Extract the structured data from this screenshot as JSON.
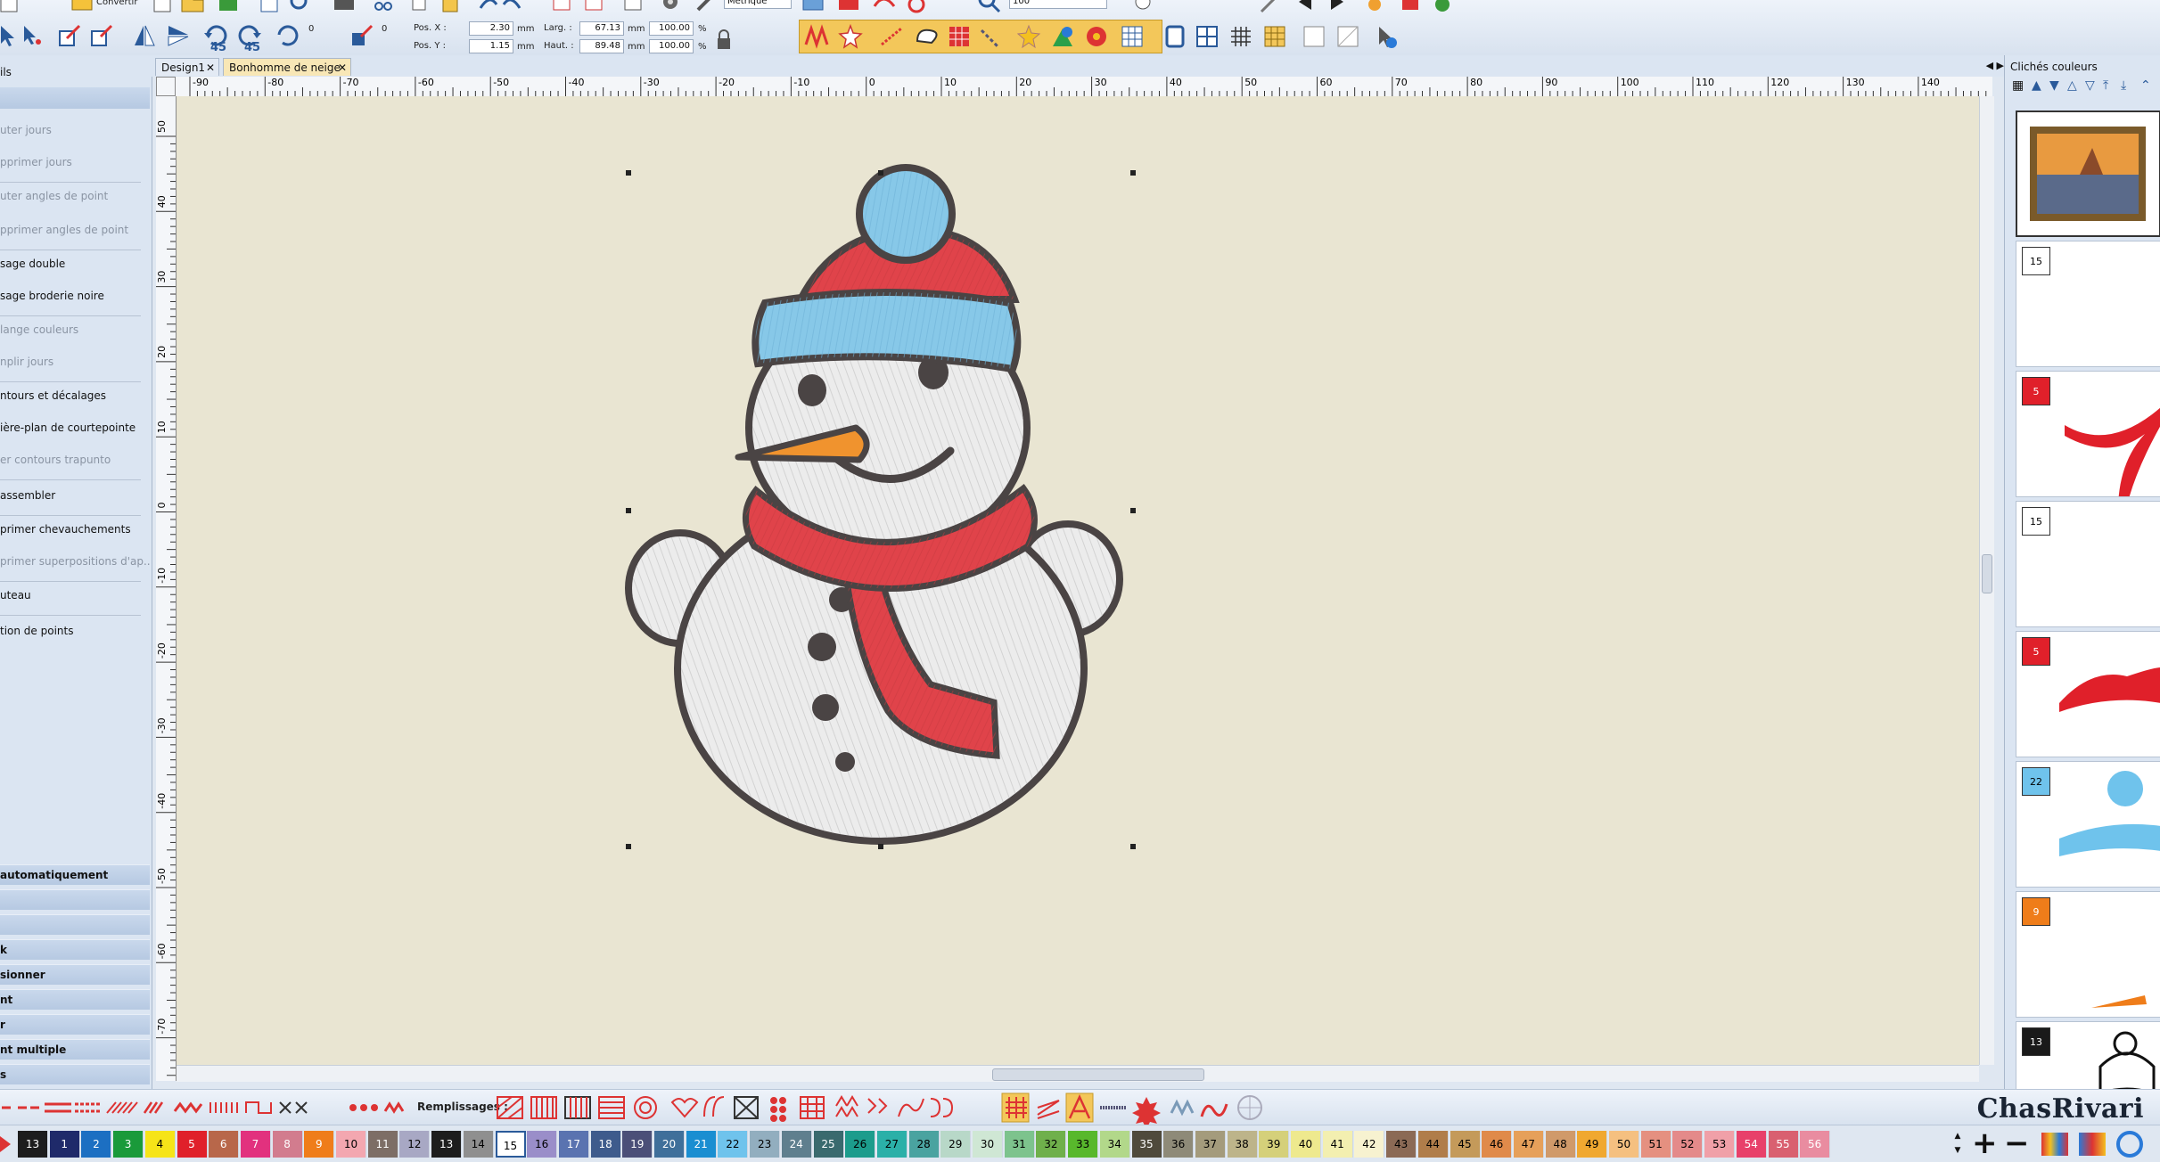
{
  "toolbar": {
    "top_labels": {
      "convert": "Convertir",
      "units": "Métrique",
      "zoom": "100"
    },
    "rotate_left_label": "45",
    "rotate_right_label": "45",
    "angle_value": "0",
    "angle_value_2": "0",
    "pos_x_label": "Pos. X :",
    "pos_x_value": "2.30",
    "pos_y_label": "Pos. Y :",
    "pos_y_value": "1.15",
    "width_label": "Larg. :",
    "width_value": "67.13",
    "height_label": "Haut. :",
    "height_value": "89.48",
    "unit": "mm",
    "width_pct": "100.00",
    "height_pct": "100.00",
    "pct": "%"
  },
  "left_panel": {
    "title": "ils",
    "items": [
      {
        "label": "uter jours",
        "disabled": true
      },
      {
        "label": "pprimer jours",
        "disabled": true
      },
      {
        "label": "uter angles de point",
        "disabled": true
      },
      {
        "label": "pprimer angles de point",
        "disabled": true
      },
      {
        "label": "sage double",
        "disabled": false
      },
      {
        "label": "sage broderie noire",
        "disabled": false
      },
      {
        "label": "lange couleurs",
        "disabled": true
      },
      {
        "label": "nplir jours",
        "disabled": true
      },
      {
        "label": "ntours et décalages",
        "disabled": false
      },
      {
        "label": "ière-plan de courtepointe",
        "disabled": false
      },
      {
        "label": "er contours trapunto",
        "disabled": true
      },
      {
        "label": "assembler",
        "disabled": false
      },
      {
        "label": "primer chevauchements",
        "disabled": false
      },
      {
        "label": "primer superpositions d'ap...",
        "disabled": true
      },
      {
        "label": "uteau",
        "disabled": false
      },
      {
        "label": "tion de points",
        "disabled": false
      }
    ],
    "bands": [
      "automatiquement",
      "",
      "",
      "k",
      "sionner",
      "nt",
      "r",
      "nt multiple",
      "s"
    ]
  },
  "tabs": [
    {
      "label": "Design1",
      "active": false
    },
    {
      "label": "Bonhomme de neige",
      "active": true
    }
  ],
  "ruler": {
    "top": [
      "-90",
      "-80",
      "-70",
      "-60",
      "-50",
      "-40",
      "-30",
      "-20",
      "-10",
      "0",
      "10",
      "20",
      "30",
      "40",
      "50",
      "60",
      "70",
      "80",
      "90",
      "100",
      "110",
      "120",
      "130",
      "140"
    ],
    "left": [
      "50",
      "40",
      "30",
      "20",
      "10",
      "0",
      "-10",
      "-20",
      "-30",
      "-40",
      "-50",
      "-60",
      "-70"
    ]
  },
  "right_panel": {
    "title": "Clichés couleurs",
    "swatches": [
      {
        "num": "15",
        "color": "#ffffff",
        "text_color": "#000000",
        "part": "body"
      },
      {
        "num": "5",
        "color": "#e0202a",
        "text_color": "#ffffff",
        "part": "scarf"
      },
      {
        "num": "15",
        "color": "#ffffff",
        "text_color": "#000000",
        "part": "face"
      },
      {
        "num": "5",
        "color": "#e0202a",
        "text_color": "#ffffff",
        "part": "hat"
      },
      {
        "num": "22",
        "color": "#6fc3ec",
        "text_color": "#000000",
        "part": "hat-band"
      },
      {
        "num": "9",
        "color": "#ef7d1a",
        "text_color": "#ffffff",
        "part": "carrot"
      },
      {
        "num": "13",
        "color": "#1a1a1a",
        "text_color": "#ffffff",
        "part": "outline"
      }
    ]
  },
  "bottom_bar": {
    "fills_label": "Remplissages :",
    "brand": "ChasRivari"
  },
  "palette": [
    {
      "n": "13",
      "c": "#1d1d1d",
      "t": "#fff"
    },
    {
      "n": "1",
      "c": "#1f2a6a",
      "t": "#fff"
    },
    {
      "n": "2",
      "c": "#1c6fc2",
      "t": "#fff"
    },
    {
      "n": "3",
      "c": "#1a9a3a",
      "t": "#fff"
    },
    {
      "n": "4",
      "c": "#f6e418",
      "t": "#000"
    },
    {
      "n": "5",
      "c": "#e0202a",
      "t": "#fff"
    },
    {
      "n": "6",
      "c": "#b8674a",
      "t": "#fff"
    },
    {
      "n": "7",
      "c": "#e2317e",
      "t": "#fff"
    },
    {
      "n": "8",
      "c": "#d27c8e",
      "t": "#fff"
    },
    {
      "n": "9",
      "c": "#ef7d1a",
      "t": "#fff"
    },
    {
      "n": "10",
      "c": "#f3a7b0",
      "t": "#000"
    },
    {
      "n": "11",
      "c": "#7d6e66",
      "t": "#fff"
    },
    {
      "n": "12",
      "c": "#a8a8c4",
      "t": "#000"
    },
    {
      "n": "13",
      "c": "#1d1d1d",
      "t": "#fff"
    },
    {
      "n": "14",
      "c": "#8f8f8f",
      "t": "#000"
    },
    {
      "n": "15",
      "c": "#ffffff",
      "t": "#000"
    },
    {
      "n": "16",
      "c": "#9a8ec9",
      "t": "#000"
    },
    {
      "n": "17",
      "c": "#5a73b0",
      "t": "#fff"
    },
    {
      "n": "18",
      "c": "#3e5b8c",
      "t": "#fff"
    },
    {
      "n": "19",
      "c": "#4b4f78",
      "t": "#fff"
    },
    {
      "n": "20",
      "c": "#3f6f9a",
      "t": "#fff"
    },
    {
      "n": "21",
      "c": "#1a8ed1",
      "t": "#fff"
    },
    {
      "n": "22",
      "c": "#6fc3ec",
      "t": "#000"
    },
    {
      "n": "23",
      "c": "#92aebf",
      "t": "#000"
    },
    {
      "n": "24",
      "c": "#5f7f8e",
      "t": "#fff"
    },
    {
      "n": "25",
      "c": "#3a6a6e",
      "t": "#fff"
    },
    {
      "n": "26",
      "c": "#1c9c8c",
      "t": "#000"
    },
    {
      "n": "27",
      "c": "#2bb0a8",
      "t": "#000"
    },
    {
      "n": "28",
      "c": "#4aa3a0",
      "t": "#000"
    },
    {
      "n": "29",
      "c": "#b8d8c8",
      "t": "#000"
    },
    {
      "n": "30",
      "c": "#cfe7d4",
      "t": "#000"
    },
    {
      "n": "31",
      "c": "#7dc38d",
      "t": "#000"
    },
    {
      "n": "32",
      "c": "#6fb04b",
      "t": "#000"
    },
    {
      "n": "33",
      "c": "#58b82c",
      "t": "#000"
    },
    {
      "n": "34",
      "c": "#b2d88a",
      "t": "#000"
    },
    {
      "n": "35",
      "c": "#4f4a3c",
      "t": "#fff"
    },
    {
      "n": "36",
      "c": "#8e8a78",
      "t": "#000"
    },
    {
      "n": "37",
      "c": "#a49b7c",
      "t": "#000"
    },
    {
      "n": "38",
      "c": "#bdb48a",
      "t": "#000"
    },
    {
      "n": "39",
      "c": "#d5d07a",
      "t": "#000"
    },
    {
      "n": "40",
      "c": "#eee98e",
      "t": "#000"
    },
    {
      "n": "41",
      "c": "#f3efb0",
      "t": "#000"
    },
    {
      "n": "42",
      "c": "#f7f2d0",
      "t": "#000"
    },
    {
      "n": "43",
      "c": "#8b6a55",
      "t": "#000"
    },
    {
      "n": "44",
      "c": "#b07d4a",
      "t": "#000"
    },
    {
      "n": "45",
      "c": "#c49a5a",
      "t": "#000"
    },
    {
      "n": "46",
      "c": "#e08a4a",
      "t": "#000"
    },
    {
      "n": "47",
      "c": "#e6a05a",
      "t": "#000"
    },
    {
      "n": "48",
      "c": "#d09a6a",
      "t": "#000"
    },
    {
      "n": "49",
      "c": "#f0a830",
      "t": "#000"
    },
    {
      "n": "50",
      "c": "#f5c080",
      "t": "#000"
    },
    {
      "n": "51",
      "c": "#e59080",
      "t": "#000"
    },
    {
      "n": "52",
      "c": "#e48a8a",
      "t": "#000"
    },
    {
      "n": "53",
      "c": "#f0a0a8",
      "t": "#000"
    },
    {
      "n": "54",
      "c": "#e8406a",
      "t": "#fff"
    },
    {
      "n": "55",
      "c": "#d96070",
      "t": "#fff"
    },
    {
      "n": "56",
      "c": "#e98ca0",
      "t": "#fff"
    }
  ],
  "colors": {
    "outline": "#4a4444",
    "snow": "#ececec",
    "red": "#e0434a",
    "blue": "#87c8e8",
    "carrot": "#f0932e"
  }
}
